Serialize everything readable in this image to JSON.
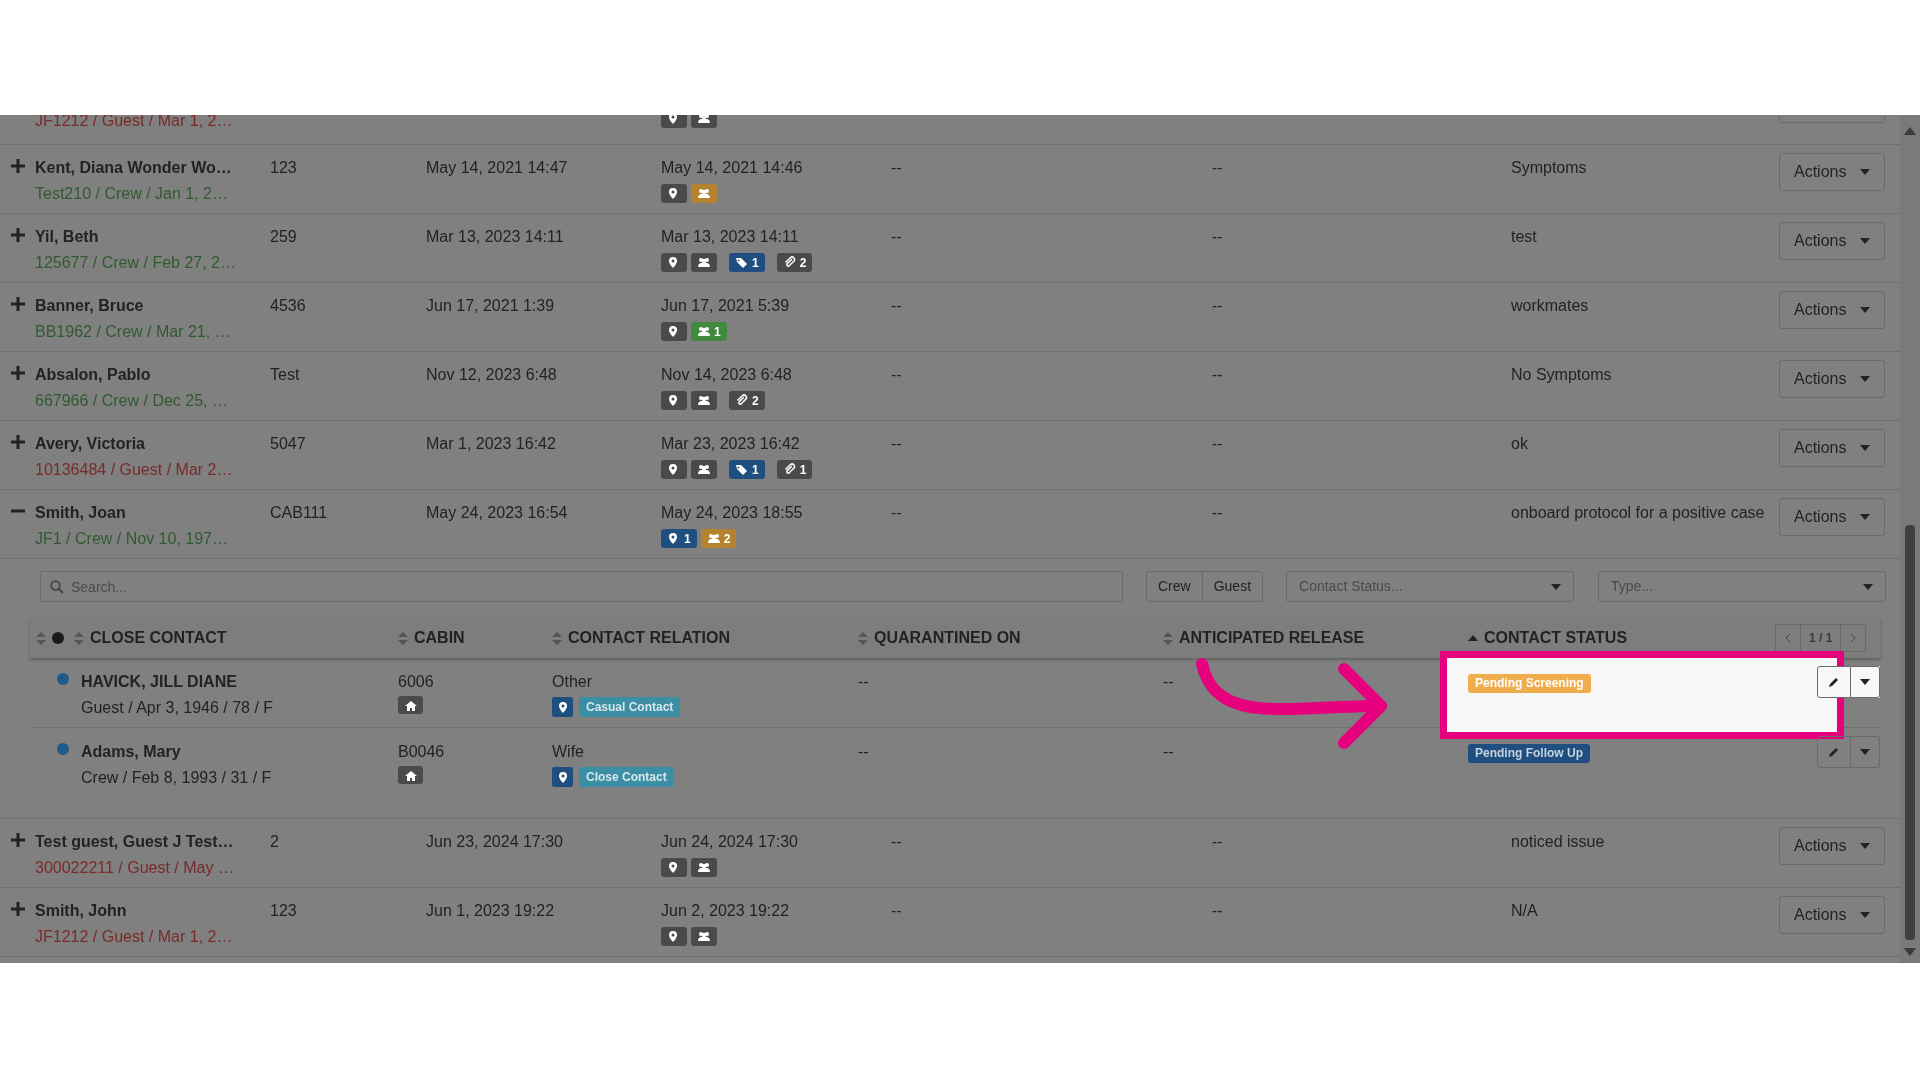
{
  "cut_row": {
    "sub": "JF1212 / Guest / Mar 1, 2…",
    "guest": true,
    "badges": [
      {
        "kind": "pin",
        "color": "#4a4a4a"
      },
      {
        "kind": "group",
        "color": "#4a4a4a"
      }
    ]
  },
  "rows": [
    {
      "name": "Kent, Diana Wonder Wo…",
      "sub": "Test210 / Crew / Jan 1, 2…",
      "guest": false,
      "cabin": "123",
      "reported": "May 14, 2021 14:47",
      "updated": "May 14, 2021 14:46",
      "badges": [
        {
          "kind": "pin",
          "color": "#4a4a4a"
        },
        {
          "kind": "group",
          "color": "#b5832f"
        }
      ],
      "column_5": "--",
      "column_6": "--",
      "notes": "Symptoms",
      "action": "Actions",
      "expanded": false
    },
    {
      "name": "Yil, Beth",
      "sub": "125677 / Crew / Feb 27, 2…",
      "guest": false,
      "cabin": "259",
      "reported": "Mar 13, 2023 14:11",
      "updated": "Mar 13, 2023 14:11",
      "badges": [
        {
          "kind": "pin",
          "color": "#4a4a4a"
        },
        {
          "kind": "group",
          "color": "#4a4a4a"
        },
        {
          "kind": "tag",
          "color": "#1f4f7f",
          "count": "1"
        },
        {
          "kind": "clip",
          "color": "#4a4a4a",
          "count": "2"
        }
      ],
      "column_5": "--",
      "column_6": "--",
      "notes": "test",
      "action": "Actions",
      "expanded": false
    },
    {
      "name": "Banner, Bruce",
      "sub": "BB1962 / Crew / Mar 21, …",
      "guest": false,
      "cabin": "4536",
      "reported": "Jun 17, 2021 1:39",
      "updated": "Jun 17, 2021 5:39",
      "badges": [
        {
          "kind": "pin",
          "color": "#4a4a4a"
        },
        {
          "kind": "group",
          "color": "#3f8a3f",
          "count": "1"
        }
      ],
      "column_5": "--",
      "column_6": "--",
      "notes": "workmates",
      "action": "Actions",
      "expanded": false
    },
    {
      "name": "Absalon, Pablo",
      "sub": "667966 / Crew / Dec 25, …",
      "guest": false,
      "cabin": "Test",
      "reported": "Nov 12, 2023 6:48",
      "updated": "Nov 14, 2023 6:48",
      "badges": [
        {
          "kind": "pin",
          "color": "#4a4a4a"
        },
        {
          "kind": "group",
          "color": "#4a4a4a"
        },
        {
          "kind": "clip",
          "color": "#4a4a4a",
          "count": "2"
        }
      ],
      "column_5": "--",
      "column_6": "--",
      "notes": "No Symptoms",
      "action": "Actions",
      "expanded": false
    },
    {
      "name": "Avery, Victoria",
      "sub": "10136484 / Guest / Mar 2…",
      "guest": true,
      "cabin": "5047",
      "reported": "Mar 1, 2023 16:42",
      "updated": "Mar 23, 2023 16:42",
      "badges": [
        {
          "kind": "pin",
          "color": "#4a4a4a"
        },
        {
          "kind": "group",
          "color": "#4a4a4a"
        },
        {
          "kind": "tag",
          "color": "#1f4f7f",
          "count": "1"
        },
        {
          "kind": "clip",
          "color": "#4a4a4a",
          "count": "1"
        }
      ],
      "column_5": "--",
      "column_6": "--",
      "notes": "ok",
      "action": "Actions",
      "expanded": false
    },
    {
      "name": "Smith, Joan",
      "sub": "JF1 / Crew / Nov 10, 197…",
      "guest": false,
      "cabin": "CAB111",
      "reported": "May 24, 2023 16:54",
      "updated": "May 24, 2023 18:55",
      "badges": [
        {
          "kind": "pin",
          "color": "#1f4f7f",
          "count": "1"
        },
        {
          "kind": "group",
          "color": "#b5832f",
          "count": "2"
        }
      ],
      "column_5": "--",
      "column_6": "--",
      "notes": "onboard protocol for a positive case",
      "action": "Actions",
      "expanded": true,
      "contacts": {
        "search": {
          "placeholder": "Search..."
        },
        "toggle": [
          "Crew",
          "Guest"
        ],
        "selects": [
          {
            "placeholder": "Contact Status..."
          },
          {
            "placeholder": "Type..."
          }
        ],
        "columns": [
          {
            "label": "CLOSE CONTACT",
            "sorted": false
          },
          {
            "label": "CABIN",
            "sorted": false
          },
          {
            "label": "CONTACT RELATION",
            "sorted": false
          },
          {
            "label": "QUARANTINED ON",
            "sorted": false
          },
          {
            "label": "ANTICIPATED RELEASE",
            "sorted": false
          },
          {
            "label": "CONTACT STATUS",
            "sorted": true
          }
        ],
        "pager": "1 / 1",
        "items": [
          {
            "name": "HAVICK, JILL DIANE",
            "details": "Guest / Apr 3, 1946 / 78 / F",
            "cabin": "6006",
            "relation": "Other",
            "type": "Casual Contact",
            "quarantined": "--",
            "release": "--",
            "status": "Pending Screening",
            "color": "#f0ad4e",
            "highlighted": true
          },
          {
            "name": "Adams, Mary",
            "details": "Crew / Feb 8, 1993 / 31 / F",
            "cabin": "B0046",
            "relation": "Wife",
            "type": "Close Contact",
            "quarantined": "--",
            "release": "--",
            "status": "Pending Follow Up",
            "color": "#1f4f7f",
            "highlighted": false
          }
        ]
      }
    },
    {
      "name": "Test guest, Guest J Test…",
      "sub": "300022211 / Guest / May …",
      "guest": true,
      "cabin": "2",
      "reported": "Jun 23, 2024 17:30",
      "updated": "Jun 24, 2024 17:30",
      "badges": [
        {
          "kind": "pin",
          "color": "#4a4a4a"
        },
        {
          "kind": "group",
          "color": "#4a4a4a"
        }
      ],
      "column_5": "--",
      "column_6": "--",
      "notes": "noticed issue",
      "action": "Actions",
      "expanded": false
    },
    {
      "name": "Smith, John",
      "sub": "JF1212 / Guest / Mar 1, 2…",
      "guest": true,
      "cabin": "123",
      "reported": "Jun 1, 2023 19:22",
      "updated": "Jun 2, 2023 19:22",
      "badges": [
        {
          "kind": "pin",
          "color": "#4a4a4a"
        },
        {
          "kind": "group",
          "color": "#4a4a4a"
        }
      ],
      "column_5": "--",
      "column_6": "--",
      "notes": "N/A",
      "action": "Actions",
      "expanded": false
    }
  ]
}
